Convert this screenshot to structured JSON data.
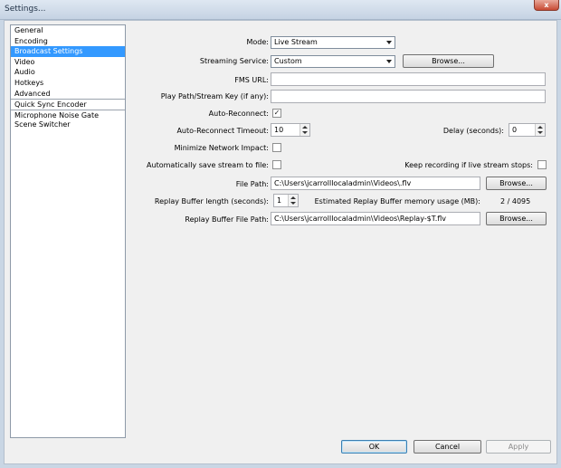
{
  "window": {
    "title": "Settings...",
    "close_glyph": "x"
  },
  "sidebar": {
    "items": [
      {
        "label": "General"
      },
      {
        "label": "Encoding"
      },
      {
        "label": "Broadcast Settings"
      },
      {
        "label": "Video"
      },
      {
        "label": "Audio"
      },
      {
        "label": "Hotkeys"
      },
      {
        "label": "Advanced"
      },
      {
        "label": "Quick Sync Encoder"
      },
      {
        "label": "Microphone Noise Gate"
      },
      {
        "label": "Scene Switcher"
      }
    ],
    "selected": "Broadcast Settings",
    "colors": {
      "selected_bg": "#3399ff",
      "selected_fg": "#ffffff"
    }
  },
  "form": {
    "mode": {
      "label": "Mode:",
      "value": "Live Stream"
    },
    "streaming_service": {
      "label": "Streaming Service:",
      "value": "Custom",
      "browse_label": "Browse..."
    },
    "fms_url": {
      "label": "FMS URL:",
      "value": ""
    },
    "play_path": {
      "label": "Play Path/Stream Key (if any):",
      "value": ""
    },
    "auto_reconnect": {
      "label": "Auto-Reconnect:",
      "checked": true,
      "glyph": "✓"
    },
    "auto_reconnect_timeout": {
      "label": "Auto-Reconnect Timeout:",
      "value": "10"
    },
    "delay": {
      "label": "Delay (seconds):",
      "value": "0"
    },
    "minimize_network_impact": {
      "label": "Minimize Network Impact:",
      "checked": false
    },
    "auto_save": {
      "label": "Automatically save stream to file:",
      "checked": false
    },
    "keep_recording": {
      "label": "Keep recording if live stream stops:",
      "checked": false
    },
    "file_path": {
      "label": "File Path:",
      "value": "C:\\Users\\jcarrolllocaladmin\\Videos\\.flv",
      "browse_label": "Browse..."
    },
    "replay_buffer_length": {
      "label": "Replay Buffer length (seconds):",
      "value": "1"
    },
    "replay_memory": {
      "label": "Estimated Replay Buffer memory usage (MB):",
      "value": "2 / 4095"
    },
    "replay_file_path": {
      "label": "Replay Buffer File Path:",
      "value": "C:\\Users\\jcarrolllocaladmin\\Videos\\Replay-$T.flv",
      "browse_label": "Browse..."
    }
  },
  "footer": {
    "ok_label": "OK",
    "cancel_label": "Cancel",
    "apply_label": "Apply"
  }
}
